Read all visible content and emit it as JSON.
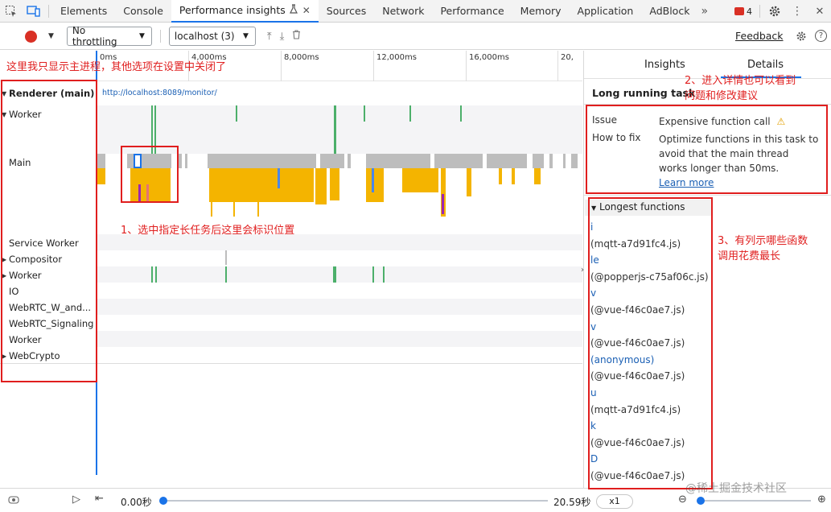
{
  "tabs": {
    "items": [
      "Elements",
      "Console",
      "Performance insights",
      "Sources",
      "Network",
      "Performance",
      "Memory",
      "Application",
      "AdBlock"
    ],
    "active_index": 2,
    "error_count": "4"
  },
  "toolbar": {
    "throttling": "No throttling",
    "target": "localhost (3)",
    "feedback": "Feedback"
  },
  "ruler": {
    "ticks": [
      "0ms",
      "4,000ms",
      "8,000ms",
      "12,000ms",
      "16,000ms",
      "20,"
    ]
  },
  "tracks": {
    "renderer": "Renderer (main)",
    "url": "http://localhost:8089/monitor/",
    "worker1": "Worker",
    "main": "Main",
    "service_worker": "Service Worker",
    "compositor": "Compositor",
    "worker2": "Worker",
    "io": "IO",
    "webrtc_w": "WebRTC_W_and...",
    "webrtc_sig": "WebRTC_Signaling",
    "worker3": "Worker",
    "webcrypto": "WebCrypto"
  },
  "details": {
    "tab_insights": "Insights",
    "tab_details": "Details",
    "title": "Long running task",
    "issue_label": "Issue",
    "issue_value": "Expensive function call",
    "fix_label": "How to fix",
    "fix_value": "Optimize functions in this task to avoid that the main thread works longer than 50ms.",
    "learn_more": "Learn more",
    "longest_header": "Longest functions",
    "functions": [
      {
        "name": "i",
        "file": "(mqtt-a7d91fc4.js)"
      },
      {
        "name": "le",
        "file": "(@popperjs-c75af06c.js)"
      },
      {
        "name": "v",
        "file": "(@vue-f46c0ae7.js)"
      },
      {
        "name": "v",
        "file": "(@vue-f46c0ae7.js)"
      },
      {
        "name": "(anonymous)",
        "file": "(@vue-f46c0ae7.js)"
      },
      {
        "name": "u",
        "file": "(mqtt-a7d91fc4.js)"
      },
      {
        "name": "k",
        "file": "(@vue-f46c0ae7.js)"
      },
      {
        "name": "D",
        "file": "(@vue-f46c0ae7.js)"
      }
    ]
  },
  "bottom": {
    "start_time": "0.00秒",
    "end_time": "20.59秒",
    "speed": "x1",
    "playback_position": 0.0
  },
  "annotations": {
    "a0": "这里我只显示主进程，其他选项在设置中关闭了",
    "a1": "1、选中指定长任务后这里会标识位置",
    "a2_line1": "2、进入详情也可以看到",
    "a2_line2": "问题和修改建议",
    "a3_line1": "3、有列示哪些函数",
    "a3_line2": "调用花费最长"
  },
  "watermark": "@稀土掘金技术社区",
  "colors": {
    "accent": "#1a73e8",
    "annotation": "#e02020",
    "record": "#d93025",
    "task_yellow": "#f4b400",
    "task_gray": "#bdbdbd",
    "worker_green": "#4caf6a"
  }
}
